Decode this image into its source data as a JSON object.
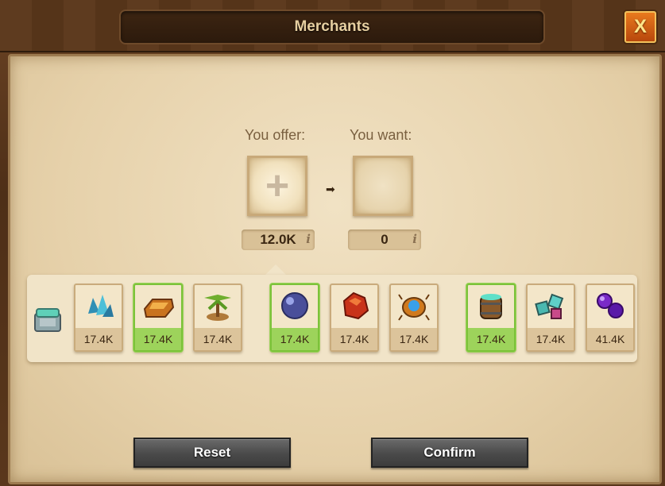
{
  "window": {
    "title": "Merchants",
    "close_label": "X"
  },
  "trade": {
    "offer_label": "You offer:",
    "want_label": "You want:",
    "offer_amount": "12.0K",
    "want_amount": "0",
    "info_glyph": "i"
  },
  "goods": [
    {
      "icon": "crystals-icon",
      "qty": "17.4K",
      "highlighted": false
    },
    {
      "icon": "gold-bar-icon",
      "qty": "17.4K",
      "highlighted": true
    },
    {
      "icon": "palm-tree-icon",
      "qty": "17.4K",
      "highlighted": false
    },
    {
      "icon": "orb-icon",
      "qty": "17.4K",
      "highlighted": true
    },
    {
      "icon": "red-rock-icon",
      "qty": "17.4K",
      "highlighted": false
    },
    {
      "icon": "scarab-icon",
      "qty": "17.4K",
      "highlighted": false
    },
    {
      "icon": "barrel-icon",
      "qty": "17.4K",
      "highlighted": true
    },
    {
      "icon": "cubes-icon",
      "qty": "17.4K",
      "highlighted": false
    },
    {
      "icon": "purple-orbs-icon",
      "qty": "41.4K",
      "highlighted": false
    }
  ],
  "buttons": {
    "reset": "Reset",
    "confirm": "Confirm"
  },
  "colors": {
    "highlight": "#9dd35b",
    "button": "#4a4a4a",
    "title": "#e7cfa0"
  }
}
